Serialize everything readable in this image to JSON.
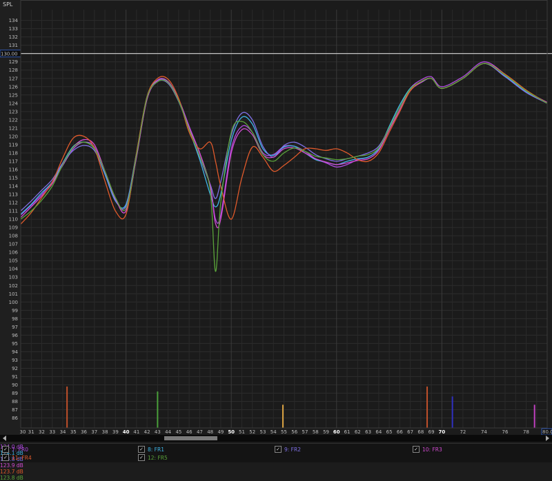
{
  "chart_data": {
    "type": "line",
    "ylabel": "SPL",
    "xlim": [
      30,
      80
    ],
    "ylim": [
      84.8,
      135.3
    ],
    "grid": true,
    "y_ticks": [
      86,
      87,
      88,
      89,
      90,
      91,
      92,
      93,
      94,
      95,
      96,
      97,
      98,
      99,
      100,
      101,
      102,
      103,
      104,
      105,
      106,
      107,
      108,
      109,
      110,
      111,
      112,
      113,
      114,
      115,
      116,
      117,
      118,
      119,
      120,
      121,
      122,
      123,
      124,
      125,
      126,
      127,
      128,
      129,
      130,
      131,
      132,
      133,
      134
    ],
    "x_ticks": [
      30,
      31,
      32,
      33,
      34,
      35,
      36,
      37,
      38,
      39,
      40,
      41,
      42,
      43,
      44,
      45,
      46,
      47,
      48,
      49,
      50,
      51,
      52,
      53,
      54,
      55,
      56,
      57,
      58,
      59,
      60,
      61,
      62,
      63,
      64,
      65,
      66,
      67,
      68,
      69,
      70,
      71,
      72,
      73,
      74,
      75,
      76,
      77,
      78,
      79,
      80
    ],
    "x_tick_labels_shown": [
      "30",
      "31",
      "32",
      "33",
      "34",
      "35",
      "36",
      "37",
      "38",
      "39",
      "40",
      "41",
      "42",
      "43",
      "44",
      "45",
      "46",
      "47",
      "48",
      "49",
      "50",
      "51",
      "52",
      "53",
      "54",
      "55",
      "56",
      "57",
      "58",
      "59",
      "60",
      "61",
      "62",
      "63",
      "64",
      "65",
      "66",
      "67",
      "68",
      "69",
      "70",
      "72",
      "74",
      "76",
      "78"
    ],
    "bold_x_labels": [
      "40",
      "50",
      "60",
      "70"
    ],
    "ref_line_y": 130.0,
    "ref_label_left": "130.00",
    "x_marker_left": "30",
    "x_marker_right": "80.00",
    "series": [
      {
        "name": "7: FR0",
        "color": "#b04be0",
        "x": [
          30,
          31,
          32,
          33,
          34,
          35,
          36,
          37,
          38,
          39,
          40,
          41,
          42,
          43,
          44,
          45,
          46,
          47,
          48,
          48.5,
          49,
          50,
          51,
          52,
          53,
          54,
          55,
          56,
          57,
          58,
          59,
          60,
          61,
          62,
          63,
          64,
          65,
          66,
          67,
          68,
          69,
          70,
          72,
          74,
          76,
          78,
          80
        ],
        "values": [
          110.5,
          111.7,
          113,
          114.5,
          116.5,
          118.5,
          119.3,
          118.7,
          115.5,
          112.5,
          111.3,
          117.5,
          124.5,
          126.7,
          126.6,
          124.5,
          121.2,
          118,
          114,
          110,
          110.5,
          118.5,
          121.2,
          120.5,
          118,
          117.8,
          118.8,
          118.8,
          118.2,
          117.3,
          116.8,
          116.3,
          116.6,
          117.2,
          117.5,
          118.5,
          121,
          123.5,
          125.8,
          126.8,
          127.2,
          126,
          127.2,
          129,
          127.5,
          125.5,
          124
        ]
      },
      {
        "name": "8: FR1",
        "color": "#3fb6e8",
        "x": [
          30,
          31,
          32,
          33,
          34,
          35,
          36,
          37,
          38,
          39,
          40,
          41,
          42,
          43,
          44,
          45,
          46,
          47,
          48,
          48.5,
          49,
          50,
          51,
          52,
          53,
          54,
          55,
          56,
          57,
          58,
          59,
          60,
          61,
          62,
          63,
          64,
          65,
          66,
          67,
          68,
          69,
          70,
          72,
          74,
          76,
          78,
          80
        ],
        "values": [
          110.6,
          111.8,
          113.2,
          114.5,
          116.8,
          118.8,
          119.3,
          118.5,
          115.4,
          112.2,
          111.8,
          118,
          124.8,
          126.8,
          126.6,
          124.4,
          120.8,
          117.2,
          113,
          111.5,
          113,
          119.5,
          122.3,
          121.5,
          118.5,
          117.7,
          118.7,
          118.8,
          118,
          117.2,
          116.9,
          116.6,
          117,
          117.3,
          117.5,
          118.5,
          121.2,
          123.8,
          125.8,
          126.5,
          127,
          125.8,
          127,
          128.8,
          127.3,
          125.4,
          124
        ]
      },
      {
        "name": "9: FR2",
        "color": "#7f70e6",
        "x": [
          30,
          31,
          32,
          33,
          34,
          35,
          36,
          37,
          38,
          39,
          40,
          41,
          42,
          43,
          44,
          45,
          46,
          47,
          48,
          48.5,
          49,
          50,
          51,
          52,
          53,
          54,
          55,
          56,
          57,
          58,
          59,
          60,
          61,
          62,
          63,
          64,
          65,
          66,
          67,
          68,
          69,
          70,
          72,
          74,
          76,
          78,
          80
        ],
        "values": [
          111,
          112.2,
          113.5,
          114.8,
          116.8,
          118.3,
          118.9,
          118.3,
          115.6,
          112.3,
          111.6,
          118,
          124.6,
          126.6,
          126.4,
          124.2,
          120.9,
          117.5,
          114.2,
          112.5,
          114.5,
          120.2,
          122.8,
          122,
          118.8,
          117.5,
          118.9,
          119.3,
          118.7,
          117.8,
          117.3,
          117,
          117.3,
          117.6,
          118,
          118.8,
          121,
          123.5,
          125.6,
          126.5,
          127,
          125.8,
          127,
          128.8,
          127.2,
          125.3,
          124
        ]
      },
      {
        "name": "10: FR3",
        "color": "#d24bd2",
        "x": [
          30,
          31,
          32,
          33,
          34,
          35,
          36,
          37,
          38,
          39,
          40,
          41,
          42,
          43,
          44,
          45,
          46,
          47,
          48,
          48.5,
          49,
          50,
          51,
          52,
          53,
          54,
          55,
          56,
          57,
          58,
          59,
          60,
          61,
          62,
          63,
          64,
          65,
          66,
          67,
          68,
          69,
          70,
          72,
          74,
          76,
          78,
          80
        ],
        "values": [
          110.2,
          111.5,
          112.8,
          114.3,
          116.6,
          118.7,
          119.6,
          119,
          115.8,
          112.5,
          111,
          117.6,
          124.5,
          126.8,
          126.6,
          124.4,
          121,
          118,
          114,
          109.5,
          110,
          118,
          120.8,
          120.2,
          117.8,
          117.5,
          118.5,
          118.6,
          118,
          117.3,
          116.9,
          116.6,
          116.8,
          117.1,
          117.3,
          118.3,
          120.8,
          123.2,
          125.5,
          126.5,
          127,
          125.8,
          127,
          128.8,
          127.4,
          125.5,
          124.1
        ]
      },
      {
        "name": "11: FR4",
        "color": "#e05a2b",
        "x": [
          30,
          31,
          32,
          33,
          34,
          35,
          36,
          37,
          38,
          39,
          40,
          41,
          42,
          43,
          44,
          45,
          46,
          47,
          48,
          48.5,
          49,
          50,
          51,
          52,
          53,
          54,
          55,
          56,
          57,
          58,
          59,
          60,
          61,
          62,
          63,
          64,
          65,
          66,
          67,
          68,
          69,
          70,
          72,
          74,
          76,
          78,
          80
        ],
        "values": [
          109.4,
          110.8,
          112.6,
          114.5,
          117.4,
          119.8,
          120,
          118.6,
          114.6,
          111,
          110.6,
          118,
          124.8,
          127,
          126.9,
          124.6,
          120.5,
          118.5,
          119.3,
          117,
          114,
          110,
          115,
          118.7,
          117.5,
          115.8,
          116.5,
          117.5,
          118.5,
          118.5,
          118.3,
          118.5,
          118,
          117.2,
          117,
          118,
          120.5,
          123,
          125.5,
          126.6,
          127,
          125.8,
          127,
          128.8,
          127.5,
          125.6,
          124
        ]
      },
      {
        "name": "12: FR5",
        "color": "#5aa33a",
        "x": [
          30,
          31,
          32,
          33,
          34,
          35,
          36,
          37,
          38,
          39,
          40,
          41,
          42,
          43,
          44,
          45,
          46,
          47,
          48,
          48.5,
          49,
          50,
          51,
          52,
          53,
          54,
          55,
          56,
          57,
          58,
          59,
          60,
          61,
          62,
          63,
          64,
          65,
          66,
          67,
          68,
          69,
          70,
          72,
          74,
          76,
          78,
          80
        ],
        "values": [
          110,
          111,
          112.3,
          114,
          116.6,
          118.7,
          119.3,
          118.5,
          115.8,
          112.6,
          111.3,
          117.8,
          124.7,
          126.6,
          126.5,
          124.3,
          120.8,
          117.6,
          113.5,
          103.7,
          112,
          120.5,
          121.8,
          120.5,
          117.8,
          117,
          118,
          118.6,
          118.2,
          117.6,
          117.4,
          117.2,
          117.3,
          117.6,
          117.8,
          118.6,
          121,
          123.5,
          125.7,
          126.6,
          127,
          125.8,
          127,
          128.8,
          127.4,
          125.5,
          124
        ]
      }
    ],
    "markers": [
      {
        "x": 34.4,
        "color": "#c0502a",
        "level": 89.8
      },
      {
        "x": 43.0,
        "color": "#4aa03a",
        "level": 89.2
      },
      {
        "x": 54.9,
        "color": "#d8a040",
        "level": 87.6
      },
      {
        "x": 68.6,
        "color": "#c0502a",
        "level": 89.8
      },
      {
        "x": 71.0,
        "color": "#3030c0",
        "level": 88.6
      },
      {
        "x": 78.8,
        "color": "#c040c0",
        "level": 87.6
      }
    ]
  },
  "legend": [
    {
      "label": "7: FR0",
      "db": "124.0 dB",
      "color": "#b04be0",
      "checked": "✓"
    },
    {
      "label": "8: FR1",
      "db": "124.1 dB",
      "color": "#3fb6e8",
      "checked": "✓"
    },
    {
      "label": "9: FR2",
      "db": "123.8 dB",
      "color": "#7f70e6",
      "checked": "✓"
    },
    {
      "label": "10: FR3",
      "db": "123.9 dB",
      "color": "#d24bd2",
      "checked": "✓"
    },
    {
      "label": "11: FR4",
      "db": "123.7 dB",
      "color": "#e05a2b",
      "checked": "✓"
    },
    {
      "label": "12: FR5",
      "db": "123.8 dB",
      "color": "#5aa33a",
      "checked": "✓"
    }
  ]
}
